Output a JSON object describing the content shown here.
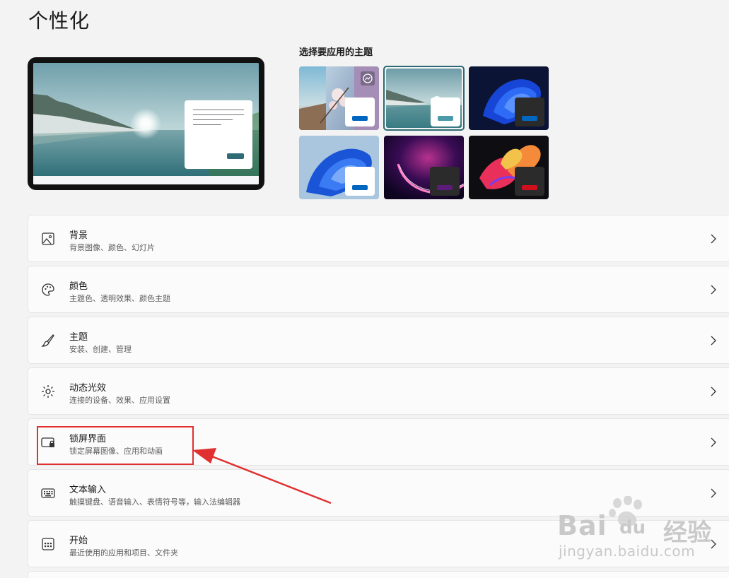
{
  "page": {
    "title": "个性化"
  },
  "themes": {
    "heading": "选择要应用的主题",
    "items": [
      {
        "name": "flower-theme",
        "swatch": "#0067c0",
        "selected": false
      },
      {
        "name": "lake-theme",
        "swatch": "#4a9aa8",
        "selected": true
      },
      {
        "name": "dark-bloom-theme",
        "swatch": "#0067c0",
        "selected": false
      },
      {
        "name": "light-bloom-theme",
        "swatch": "#0067c0",
        "selected": false
      },
      {
        "name": "glow-theme",
        "swatch": "#5d1b7a",
        "selected": false
      },
      {
        "name": "captured-motion-theme",
        "swatch": "#d0101c",
        "selected": false
      }
    ]
  },
  "settings": [
    {
      "key": "background",
      "icon": "image-icon",
      "title": "背景",
      "subtitle": "背景图像、颜色、幻灯片"
    },
    {
      "key": "colors",
      "icon": "palette-icon",
      "title": "颜色",
      "subtitle": "主题色、透明效果、颜色主题"
    },
    {
      "key": "themes",
      "icon": "brush-icon",
      "title": "主题",
      "subtitle": "安装、创建、管理"
    },
    {
      "key": "dynamic-lighting",
      "icon": "lighting-icon",
      "title": "动态光效",
      "subtitle": "连接的设备、效果、应用设置"
    },
    {
      "key": "lock-screen",
      "icon": "lock-screen-icon",
      "title": "锁屏界面",
      "subtitle": "锁定屏幕图像、应用和动画"
    },
    {
      "key": "text-input",
      "icon": "keyboard-icon",
      "title": "文本输入",
      "subtitle": "触摸键盘、语音输入、表情符号等，输入法编辑器"
    },
    {
      "key": "start",
      "icon": "start-icon",
      "title": "开始",
      "subtitle": "最近使用的应用和项目、文件夹"
    }
  ],
  "annotation": {
    "color": "#e03030"
  },
  "watermark": {
    "brand": "Bai",
    "brand_suffix": "du",
    "product": "经验",
    "url": "jingyan.baidu.com"
  }
}
